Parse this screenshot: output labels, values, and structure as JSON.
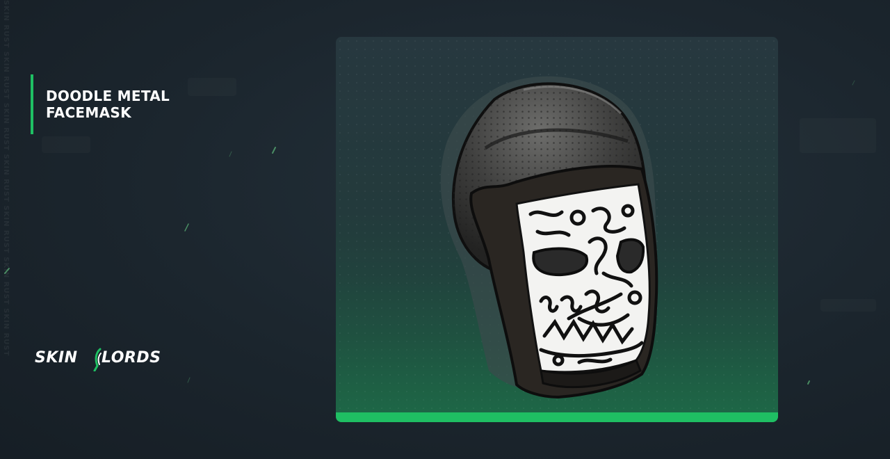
{
  "item": {
    "title_line1": "DOODLE METAL",
    "title_line2": "FACEMASK",
    "image_icon": "doodle-metal-facemask-icon"
  },
  "brand": {
    "name_left": "SKIN",
    "name_right": "LORDS",
    "logo_icon": "skinlords-logo-icon"
  },
  "background": {
    "watermark_text": "SKIN RUST SKIN RUST SKIN RUST SKIN RUST SKIN RUST SKIN RUST SKIN RUST"
  },
  "colors": {
    "accent": "#1fbf63",
    "background": "#1b252d",
    "card_top": "#27383f",
    "card_bottom": "#1d5a42"
  }
}
